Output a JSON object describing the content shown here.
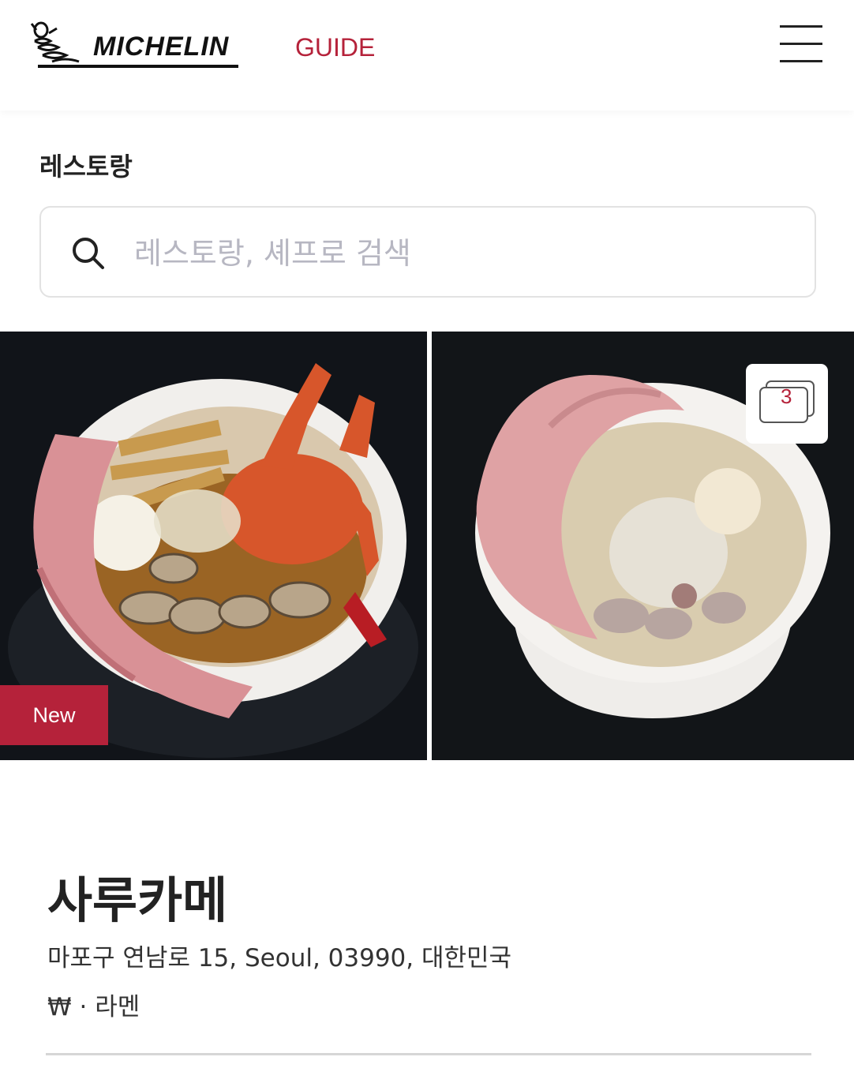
{
  "header": {
    "brand": "MICHELIN",
    "guide_label": "GUIDE"
  },
  "section": {
    "title": "레스토랑"
  },
  "search": {
    "placeholder": "레스토랑, 셰프로 검색",
    "value": ""
  },
  "gallery": {
    "badge": "New",
    "count": "3"
  },
  "restaurant": {
    "name": "사루카메",
    "address": "마포구 연남로 15, Seoul, 03990, 대한민국",
    "price": "₩",
    "separator": " · ",
    "cuisine": "라멘"
  },
  "colors": {
    "accent": "#b5223a",
    "text": "#222222",
    "placeholder": "#b7b7c2"
  },
  "icons": {
    "menu": "hamburger-icon",
    "search": "search-icon",
    "gallery": "gallery-stack-icon",
    "logo": "bibendum-logo-icon"
  }
}
